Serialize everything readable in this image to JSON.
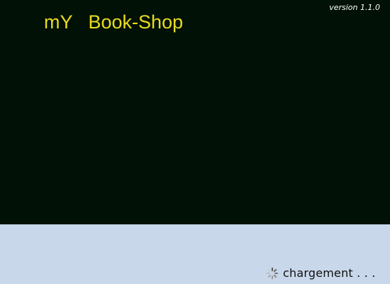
{
  "app": {
    "title": "mY   Book-Shop",
    "version": "version 1.1.0"
  },
  "loading": {
    "text": "chargement . . .",
    "icon": "spinner-icon"
  },
  "colors": {
    "panel_background": "#011106",
    "footer_background": "#c8d7ea",
    "title_color": "#e8dc1d",
    "version_color": "#ffffff"
  }
}
